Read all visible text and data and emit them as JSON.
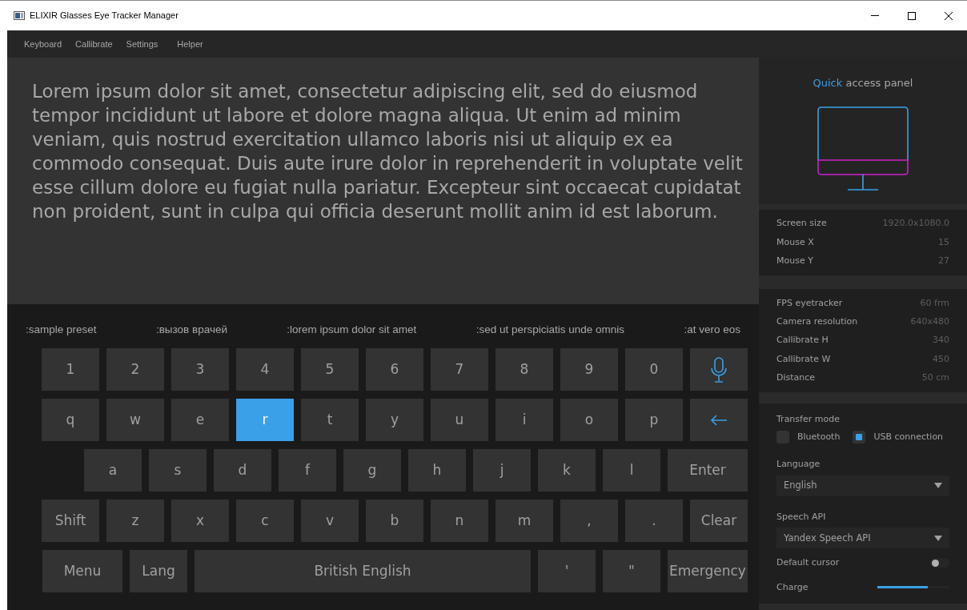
{
  "window": {
    "title": "ELIXIR Glasses Eye Tracker Manager"
  },
  "menu": [
    "Keyboard",
    "Callibrate",
    "Settings",
    "Helper"
  ],
  "text_area": {
    "value": "Lorem ipsum dolor sit amet, consectetur adipiscing elit, sed do eiusmod tempor incididunt ut labore et dolore magna aliqua. Ut enim ad minim veniam, quis nostrud exercitation ullamco laboris nisi ut aliquip ex ea commodo consequat. Duis aute irure dolor in reprehenderit in voluptate velit esse cillum dolore eu fugiat nulla pariatur. Excepteur sint occaecat cupidatat non proident, sunt in culpa qui officia deserunt mollit anim id est laborum."
  },
  "presets": [
    ":sample preset",
    ":вызов врачей",
    ":lorem ipsum dolor sit amet",
    ":sed ut perspiciatis unde omnis",
    ":at vero eos"
  ],
  "keyboard": {
    "lines": [
      {
        "keys": [
          {
            "kind": "char",
            "label": "1",
            "selected": false
          },
          {
            "kind": "char",
            "label": "2",
            "selected": false
          },
          {
            "kind": "char",
            "label": "3",
            "selected": false
          },
          {
            "kind": "char",
            "label": "4",
            "selected": false
          },
          {
            "kind": "char",
            "label": "5",
            "selected": false
          },
          {
            "kind": "char",
            "label": "6",
            "selected": false
          },
          {
            "kind": "char",
            "label": "7",
            "selected": false
          },
          {
            "kind": "char",
            "label": "8",
            "selected": false
          },
          {
            "kind": "char",
            "label": "9",
            "selected": false
          },
          {
            "kind": "char",
            "label": "0",
            "selected": false
          },
          {
            "kind": "mic",
            "selected": false
          }
        ]
      },
      {
        "keys": [
          {
            "kind": "char",
            "label": "q",
            "selected": false
          },
          {
            "kind": "char",
            "label": "w",
            "selected": false
          },
          {
            "kind": "char",
            "label": "e",
            "selected": false
          },
          {
            "kind": "char",
            "label": "r",
            "selected": true
          },
          {
            "kind": "char",
            "label": "t",
            "selected": false
          },
          {
            "kind": "char",
            "label": "y",
            "selected": false
          },
          {
            "kind": "char",
            "label": "u",
            "selected": false
          },
          {
            "kind": "char",
            "label": "i",
            "selected": false
          },
          {
            "kind": "char",
            "label": "o",
            "selected": false
          },
          {
            "kind": "char",
            "label": "p",
            "selected": false
          },
          {
            "kind": "backspace",
            "selected": false
          }
        ]
      },
      {
        "keys": [
          {
            "kind": "char",
            "label": "a",
            "selected": false
          },
          {
            "kind": "char",
            "label": "s",
            "selected": false
          },
          {
            "kind": "char",
            "label": "d",
            "selected": false
          },
          {
            "kind": "char",
            "label": "f",
            "selected": false
          },
          {
            "kind": "char",
            "label": "g",
            "selected": false
          },
          {
            "kind": "char",
            "label": "h",
            "selected": false
          },
          {
            "kind": "char",
            "label": "j",
            "selected": false
          },
          {
            "kind": "char",
            "label": "k",
            "selected": false
          },
          {
            "kind": "char",
            "label": "l",
            "selected": false
          },
          {
            "kind": "wide",
            "label": "Enter",
            "selected": false
          }
        ]
      },
      {
        "keys": [
          {
            "kind": "char",
            "label": "Shift",
            "selected": false
          },
          {
            "kind": "char",
            "label": "z",
            "selected": false
          },
          {
            "kind": "char",
            "label": "x",
            "selected": false
          },
          {
            "kind": "char",
            "label": "c",
            "selected": false
          },
          {
            "kind": "char",
            "label": "v",
            "selected": false
          },
          {
            "kind": "char",
            "label": "b",
            "selected": false
          },
          {
            "kind": "char",
            "label": "n",
            "selected": false
          },
          {
            "kind": "char",
            "label": "m",
            "selected": false
          },
          {
            "kind": "char",
            "label": ",",
            "selected": false
          },
          {
            "kind": "char",
            "label": ".",
            "selected": false
          },
          {
            "kind": "char",
            "label": "Clear",
            "selected": false
          }
        ]
      },
      {
        "keys": [
          {
            "kind": "wide",
            "label": "Menu",
            "selected": false
          },
          {
            "kind": "char",
            "label": "Lang",
            "selected": false
          },
          {
            "kind": "space",
            "label": "British English",
            "selected": false
          },
          {
            "kind": "char",
            "label": "'",
            "selected": false
          },
          {
            "kind": "char",
            "label": "\"",
            "selected": false
          },
          {
            "kind": "emergency",
            "label": "Emergency",
            "selected": false
          }
        ]
      }
    ]
  },
  "panel": {
    "title_accent": "Quick",
    "title_rest": "access panel",
    "info_groups": [
      [
        {
          "label": "Screen size",
          "value": "1920.0x1080.0"
        },
        {
          "label": "Mouse X",
          "value": "15"
        },
        {
          "label": "Mouse Y",
          "value": "27"
        }
      ],
      [
        {
          "label": "FPS eyetracker",
          "value": "60 frm"
        },
        {
          "label": "Camera resolution",
          "value": "640x480"
        },
        {
          "label": "Callibrate H",
          "value": "340"
        },
        {
          "label": "Callibrate W",
          "value": "450"
        },
        {
          "label": "Distance",
          "value": "50 cm"
        }
      ]
    ],
    "transfer_mode": {
      "label": "Transfer mode",
      "options": [
        {
          "label": "Bluetooth",
          "selected": false
        },
        {
          "label": "USB connection",
          "selected": true
        }
      ]
    },
    "language": {
      "label": "Language",
      "value": "English"
    },
    "speech_api": {
      "label": "Speech API",
      "value": "Yandex Speech API"
    },
    "default_cursor": {
      "label": "Default cursor",
      "on": false
    },
    "charge": {
      "label": "Charge",
      "level": 0.7
    }
  }
}
